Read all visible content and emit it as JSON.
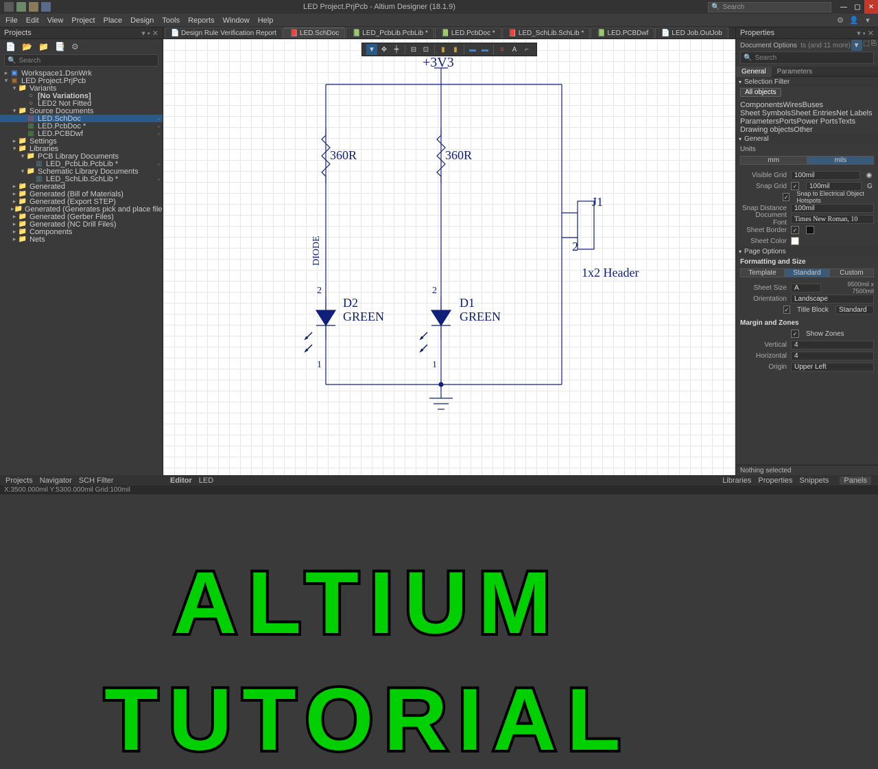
{
  "title": "LED Project.PrjPcb - Altium Designer (18.1.9)",
  "search_placeholder": "Search",
  "menu": [
    "File",
    "Edit",
    "View",
    "Project",
    "Place",
    "Design",
    "Tools",
    "Reports",
    "Window",
    "Help"
  ],
  "left": {
    "panel_title": "Projects",
    "search": "Search",
    "bottom_tabs": [
      "Projects",
      "Navigator",
      "SCH Filter"
    ],
    "tree": [
      {
        "d": 0,
        "c": "▸",
        "i": "ws",
        "t": "Workspace1.DsnWrk"
      },
      {
        "d": 0,
        "c": "▾",
        "i": "prj",
        "t": "LED Project.PrjPcb",
        "sel": false
      },
      {
        "d": 1,
        "c": "▾",
        "i": "fld",
        "t": "Variants"
      },
      {
        "d": 2,
        "c": " ",
        "i": "txt",
        "t": "[No Variations]",
        "bold": true
      },
      {
        "d": 2,
        "c": " ",
        "i": "txt",
        "t": "LED2 Not Fitted"
      },
      {
        "d": 1,
        "c": "▾",
        "i": "fld",
        "t": "Source Documents"
      },
      {
        "d": 2,
        "c": " ",
        "i": "sch",
        "t": "LED.SchDoc",
        "sel": true,
        "b": "▫"
      },
      {
        "d": 2,
        "c": " ",
        "i": "pcb",
        "t": "LED.PcbDoc *",
        "b": "▫"
      },
      {
        "d": 2,
        "c": " ",
        "i": "pcb",
        "t": "LED.PCBDwf",
        "b": "▫"
      },
      {
        "d": 1,
        "c": "▸",
        "i": "fld",
        "t": "Settings"
      },
      {
        "d": 1,
        "c": "▾",
        "i": "fld",
        "t": "Libraries"
      },
      {
        "d": 2,
        "c": "▾",
        "i": "fld",
        "t": "PCB Library Documents"
      },
      {
        "d": 3,
        "c": " ",
        "i": "lib",
        "t": "LED_PcbLib.PcbLib *",
        "b": "▫"
      },
      {
        "d": 2,
        "c": "▾",
        "i": "fld",
        "t": "Schematic Library Documents"
      },
      {
        "d": 3,
        "c": " ",
        "i": "lib",
        "t": "LED_SchLib.SchLib *",
        "b": "▫"
      },
      {
        "d": 1,
        "c": "▸",
        "i": "fld",
        "t": "Generated"
      },
      {
        "d": 1,
        "c": "▸",
        "i": "fld",
        "t": "Generated (Bill of Materials)"
      },
      {
        "d": 1,
        "c": "▸",
        "i": "fld",
        "t": "Generated (Export STEP)"
      },
      {
        "d": 1,
        "c": "▸",
        "i": "fld",
        "t": "Generated (Generates pick and place files)"
      },
      {
        "d": 1,
        "c": "▸",
        "i": "fld",
        "t": "Generated (Gerber Files)"
      },
      {
        "d": 1,
        "c": "▸",
        "i": "fld",
        "t": "Generated (NC Drill Files)"
      },
      {
        "d": 1,
        "c": "▸",
        "i": "fld",
        "t": "Components"
      },
      {
        "d": 1,
        "c": "▸",
        "i": "fld",
        "t": "Nets"
      }
    ]
  },
  "tabs": [
    {
      "i": "📄",
      "t": "Design Rule Verification Report",
      "active": false
    },
    {
      "i": "📕",
      "t": "LED.SchDoc",
      "active": true
    },
    {
      "i": "📗",
      "t": "LED_PcbLib.PcbLib *",
      "active": false
    },
    {
      "i": "📗",
      "t": "LED.PcbDoc *",
      "active": false
    },
    {
      "i": "📕",
      "t": "LED_SchLib.SchLib *",
      "active": false
    },
    {
      "i": "📗",
      "t": "LED.PCBDwf",
      "active": false
    },
    {
      "i": "📄",
      "t": "LED Job.OutJob",
      "active": false
    }
  ],
  "sch": {
    "power": "+3V3",
    "r_value": "360R",
    "d1_ref": "D1",
    "d1_val": "GREEN",
    "d2_ref": "D2",
    "d2_val": "GREEN",
    "j_ref": "J1",
    "j_pin": "2",
    "j_type": "1x2 Header",
    "diode_label": "DIODE",
    "pin2": "2",
    "pin1": "1"
  },
  "center_bottom": {
    "a": "Editor",
    "b": "LED"
  },
  "right": {
    "panel_title": "Properties",
    "doc_opts": "Document Options",
    "ts": "ts (and 11 more)",
    "search": "Search",
    "mini_tabs": [
      "General",
      "Parameters"
    ],
    "sel_filter": "Selection Filter",
    "all_obj": "All objects",
    "tags": [
      "Components",
      "Wires",
      "Buses",
      "Sheet Symbols",
      "Sheet Entries",
      "Net Labels",
      "Parameters",
      "Ports",
      "Power Ports",
      "Texts",
      "Drawing objects",
      "Other"
    ],
    "general": "General",
    "units": "Units",
    "mm": "mm",
    "mils": "mils",
    "visible_grid": "Visible Grid",
    "vg_val": "100mil",
    "snap_grid": "Snap Grid",
    "sg_val": "100mil",
    "sg_g": "G",
    "snap_hot": "Snap to Electrical Object Hotspots",
    "snap_dist": "Snap Distance",
    "sd_val": "100mil",
    "doc_font": "Document Font",
    "df_val": "Times New Roman, 10",
    "sheet_border": "Sheet Border",
    "sheet_color": "Sheet Color",
    "page_opts": "Page Options",
    "fmt_size": "Formatting and Size",
    "seg3": [
      "Template",
      "Standard",
      "Custom"
    ],
    "sheet_size": "Sheet Size",
    "ss_val": "A",
    "ss_dim": "9500mil x 7500mil",
    "orientation": "Orientation",
    "or_val": "Landscape",
    "title_block": "Title Block",
    "tb_val": "Standard",
    "margin": "Margin and Zones",
    "show_zones": "Show Zones",
    "vertical": "Vertical",
    "v_val": "4",
    "horizontal": "Horizontal",
    "h_val": "4",
    "origin": "Origin",
    "origin_val": "Upper Left",
    "nothing": "Nothing selected",
    "bottom_tabs": [
      "Libraries",
      "Properties",
      "Snippets"
    ],
    "panels_btn": "Panels"
  },
  "status": "X:3500.000mil Y:5300.000mil   Grid:100mil",
  "overlay": {
    "a": "ALTIUM",
    "b": "TUTORIAL"
  }
}
